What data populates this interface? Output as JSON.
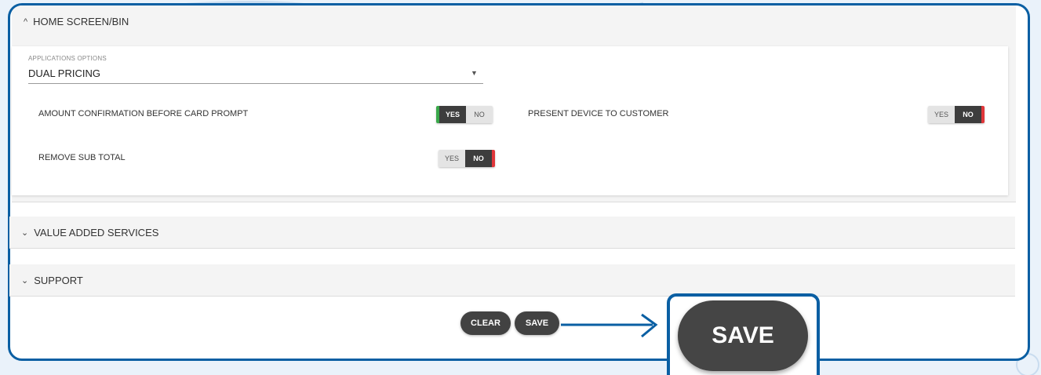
{
  "home_screen": {
    "title": "HOME SCREEN/BIN",
    "application_options": {
      "label": "APPLICATIONS OPTIONS",
      "value": "DUAL PRICING"
    },
    "amount_confirmation": {
      "label": "AMOUNT CONFIRMATION BEFORE CARD PROMPT",
      "yes": "YES",
      "no": "NO",
      "selected": "YES"
    },
    "present_device": {
      "label": "PRESENT DEVICE TO CUSTOMER",
      "yes": "YES",
      "no": "NO",
      "selected": "NO"
    },
    "remove_sub_total": {
      "label": "REMOVE SUB TOTAL",
      "yes": "YES",
      "no": "NO",
      "selected": "NO"
    }
  },
  "value_added_services": {
    "title": "VALUE ADDED SERVICES"
  },
  "support": {
    "title": "SUPPORT"
  },
  "actions": {
    "clear": "CLEAR",
    "save": "SAVE"
  },
  "callout": {
    "save_label": "SAVE"
  },
  "colors": {
    "accent_blue": "#0a5fa3",
    "toggle_yes_green": "#3aa84a",
    "toggle_no_red": "#e0363a",
    "button_dark": "#424242"
  },
  "icons": {
    "expand_up": "chevron-up-icon",
    "expand_down": "chevron-down-icon",
    "dropdown": "caret-down-icon",
    "arrow": "arrow-right-icon"
  }
}
